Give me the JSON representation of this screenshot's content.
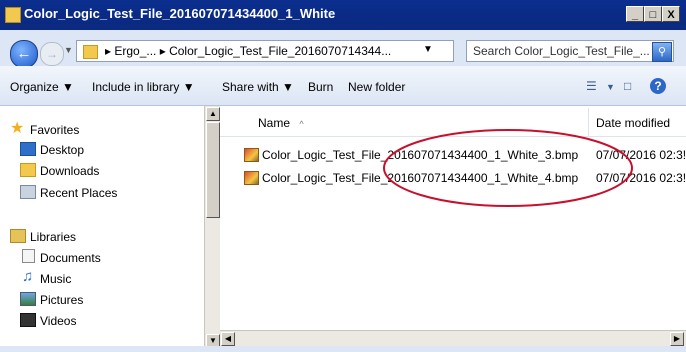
{
  "window": {
    "title": "Color_Logic_Test_File_201607071434400_1_White",
    "controls": [
      "_",
      "□",
      "X"
    ]
  },
  "address": {
    "path": "▸ Ergo_...  ▸ Color_Logic_Test_File_2016070714344...",
    "dropdown": "▼"
  },
  "search": {
    "placeholder": "Search Color_Logic_Test_File_..."
  },
  "toolbar": {
    "organize": "Organize ▼",
    "include": "Include in library ▼",
    "share": "Share with ▼",
    "burn": "Burn",
    "new_folder": "New folder"
  },
  "nav": {
    "favorites": "Favorites",
    "desktop": "Desktop",
    "downloads": "Downloads",
    "recent": "Recent Places",
    "libraries": "Libraries",
    "documents": "Documents",
    "music": "Music",
    "pictures": "Pictures",
    "videos": "Videos"
  },
  "columns": {
    "name": "Name",
    "sort": "^",
    "date": "Date modified"
  },
  "files": [
    {
      "name": "Color_Logic_Test_File_201607071434400_1_White_3.bmp",
      "date": "07/07/2016 02:3!"
    },
    {
      "name": "Color_Logic_Test_File_201607071434400_1_White_4.bmp",
      "date": "07/07/2016 02:3!"
    }
  ],
  "colors": {
    "highlight": "#c8102e",
    "titlebar": "#0a2a86"
  }
}
